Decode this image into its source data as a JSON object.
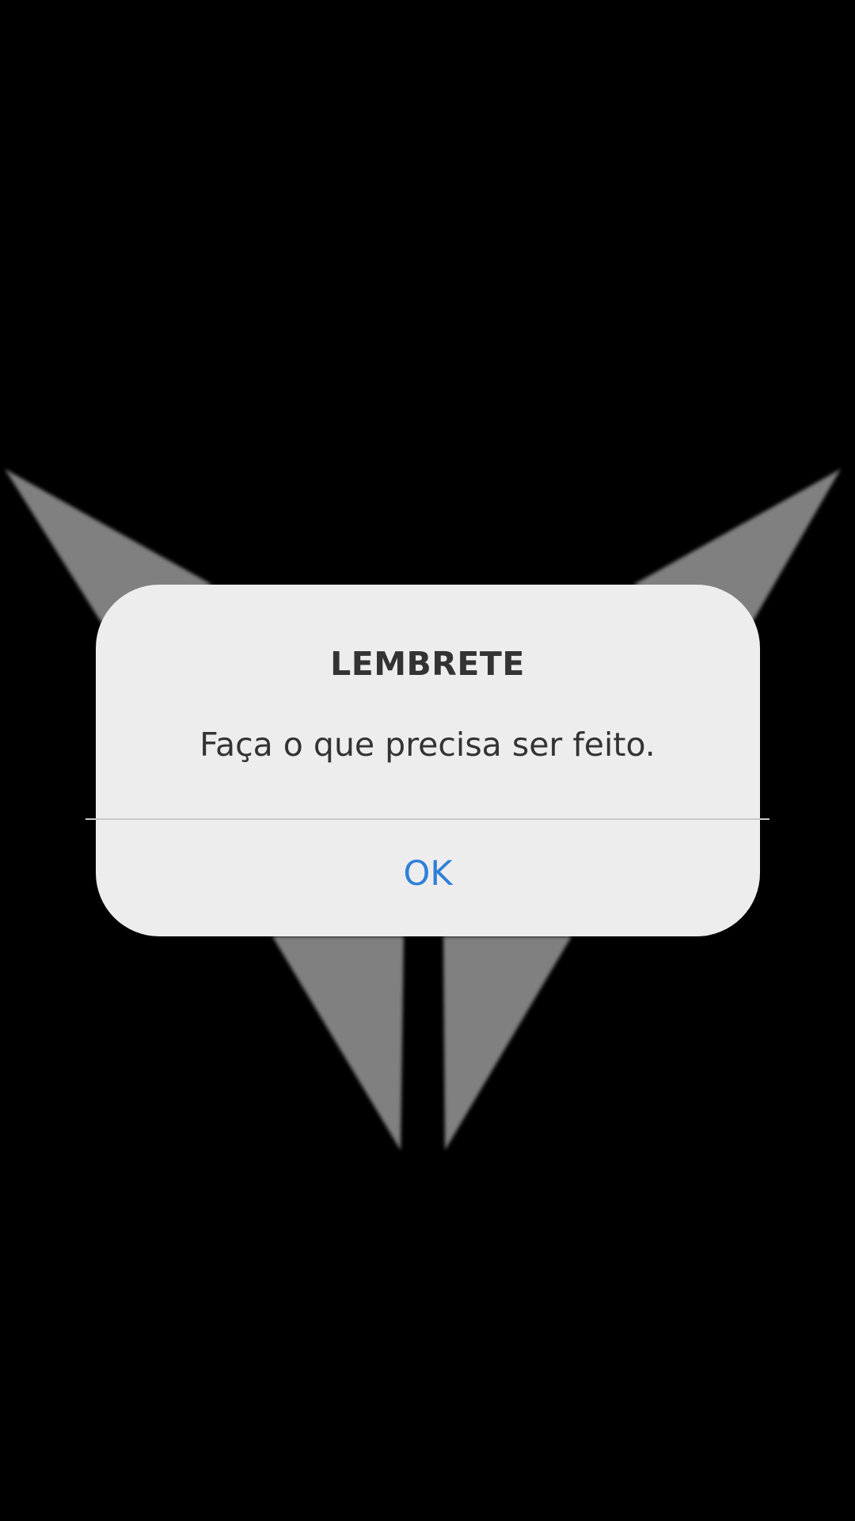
{
  "colors": {
    "background": "#000000",
    "logo": "#808080",
    "dialog_background": "#ededed",
    "title_text": "#333333",
    "message_text": "#333333",
    "divider": "#c9c9c9",
    "accent": "#2f7fd9"
  },
  "background_logo": {
    "icon": "stylized-wolf-logo-icon"
  },
  "dialog": {
    "title": "LEMBRETE",
    "message": "Faça o que precisa ser feito.",
    "ok_label": "OK"
  }
}
